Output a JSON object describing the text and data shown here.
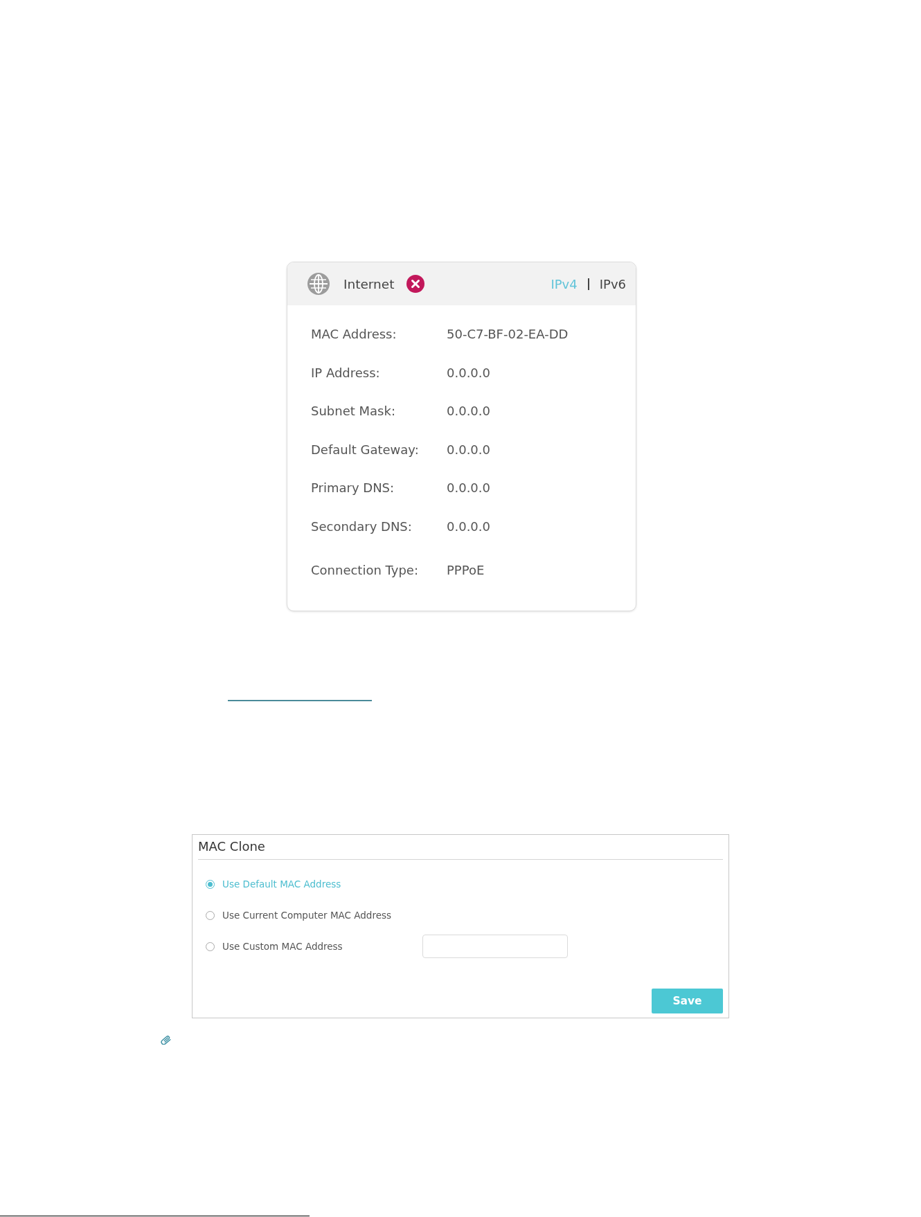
{
  "internet_panel": {
    "title": "Internet",
    "connected": false,
    "protocol_tabs": [
      {
        "label": "IPv4",
        "selected": true
      },
      {
        "label": "IPv6",
        "selected": false
      }
    ],
    "fields": [
      {
        "label": "MAC Address:",
        "value": "50-C7-BF-02-EA-DD"
      },
      {
        "label": "IP Address:",
        "value": "0.0.0.0"
      },
      {
        "label": "Subnet Mask:",
        "value": "0.0.0.0"
      },
      {
        "label": "Default Gateway:",
        "value": "0.0.0.0"
      },
      {
        "label": "Primary DNS:",
        "value": "0.0.0.0"
      },
      {
        "label": "Secondary DNS:",
        "value": "0.0.0.0"
      },
      {
        "label": "Connection Type:",
        "value": "PPPoE"
      }
    ]
  },
  "mac_clone": {
    "title": "MAC Clone",
    "options": [
      {
        "label": "Use Default MAC Address",
        "selected": true,
        "kind": "plain"
      },
      {
        "label": "Use Current Computer MAC Address",
        "selected": false,
        "kind": "plain"
      },
      {
        "label": "Use Custom MAC Address",
        "selected": false,
        "kind": "with_input"
      }
    ],
    "save_button": "Save"
  }
}
